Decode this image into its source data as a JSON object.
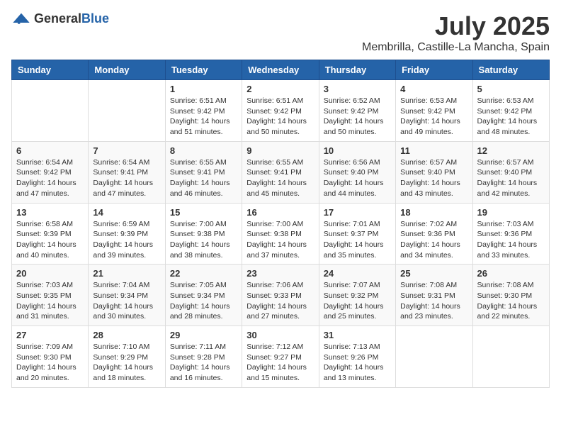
{
  "logo": {
    "general": "General",
    "blue": "Blue"
  },
  "title": "July 2025",
  "subtitle": "Membrilla, Castille-La Mancha, Spain",
  "days_of_week": [
    "Sunday",
    "Monday",
    "Tuesday",
    "Wednesday",
    "Thursday",
    "Friday",
    "Saturday"
  ],
  "weeks": [
    [
      {
        "day": "",
        "sunrise": "",
        "sunset": "",
        "daylight": ""
      },
      {
        "day": "",
        "sunrise": "",
        "sunset": "",
        "daylight": ""
      },
      {
        "day": "1",
        "sunrise": "Sunrise: 6:51 AM",
        "sunset": "Sunset: 9:42 PM",
        "daylight": "Daylight: 14 hours and 51 minutes."
      },
      {
        "day": "2",
        "sunrise": "Sunrise: 6:51 AM",
        "sunset": "Sunset: 9:42 PM",
        "daylight": "Daylight: 14 hours and 50 minutes."
      },
      {
        "day": "3",
        "sunrise": "Sunrise: 6:52 AM",
        "sunset": "Sunset: 9:42 PM",
        "daylight": "Daylight: 14 hours and 50 minutes."
      },
      {
        "day": "4",
        "sunrise": "Sunrise: 6:53 AM",
        "sunset": "Sunset: 9:42 PM",
        "daylight": "Daylight: 14 hours and 49 minutes."
      },
      {
        "day": "5",
        "sunrise": "Sunrise: 6:53 AM",
        "sunset": "Sunset: 9:42 PM",
        "daylight": "Daylight: 14 hours and 48 minutes."
      }
    ],
    [
      {
        "day": "6",
        "sunrise": "Sunrise: 6:54 AM",
        "sunset": "Sunset: 9:42 PM",
        "daylight": "Daylight: 14 hours and 47 minutes."
      },
      {
        "day": "7",
        "sunrise": "Sunrise: 6:54 AM",
        "sunset": "Sunset: 9:41 PM",
        "daylight": "Daylight: 14 hours and 47 minutes."
      },
      {
        "day": "8",
        "sunrise": "Sunrise: 6:55 AM",
        "sunset": "Sunset: 9:41 PM",
        "daylight": "Daylight: 14 hours and 46 minutes."
      },
      {
        "day": "9",
        "sunrise": "Sunrise: 6:55 AM",
        "sunset": "Sunset: 9:41 PM",
        "daylight": "Daylight: 14 hours and 45 minutes."
      },
      {
        "day": "10",
        "sunrise": "Sunrise: 6:56 AM",
        "sunset": "Sunset: 9:40 PM",
        "daylight": "Daylight: 14 hours and 44 minutes."
      },
      {
        "day": "11",
        "sunrise": "Sunrise: 6:57 AM",
        "sunset": "Sunset: 9:40 PM",
        "daylight": "Daylight: 14 hours and 43 minutes."
      },
      {
        "day": "12",
        "sunrise": "Sunrise: 6:57 AM",
        "sunset": "Sunset: 9:40 PM",
        "daylight": "Daylight: 14 hours and 42 minutes."
      }
    ],
    [
      {
        "day": "13",
        "sunrise": "Sunrise: 6:58 AM",
        "sunset": "Sunset: 9:39 PM",
        "daylight": "Daylight: 14 hours and 40 minutes."
      },
      {
        "day": "14",
        "sunrise": "Sunrise: 6:59 AM",
        "sunset": "Sunset: 9:39 PM",
        "daylight": "Daylight: 14 hours and 39 minutes."
      },
      {
        "day": "15",
        "sunrise": "Sunrise: 7:00 AM",
        "sunset": "Sunset: 9:38 PM",
        "daylight": "Daylight: 14 hours and 38 minutes."
      },
      {
        "day": "16",
        "sunrise": "Sunrise: 7:00 AM",
        "sunset": "Sunset: 9:38 PM",
        "daylight": "Daylight: 14 hours and 37 minutes."
      },
      {
        "day": "17",
        "sunrise": "Sunrise: 7:01 AM",
        "sunset": "Sunset: 9:37 PM",
        "daylight": "Daylight: 14 hours and 35 minutes."
      },
      {
        "day": "18",
        "sunrise": "Sunrise: 7:02 AM",
        "sunset": "Sunset: 9:36 PM",
        "daylight": "Daylight: 14 hours and 34 minutes."
      },
      {
        "day": "19",
        "sunrise": "Sunrise: 7:03 AM",
        "sunset": "Sunset: 9:36 PM",
        "daylight": "Daylight: 14 hours and 33 minutes."
      }
    ],
    [
      {
        "day": "20",
        "sunrise": "Sunrise: 7:03 AM",
        "sunset": "Sunset: 9:35 PM",
        "daylight": "Daylight: 14 hours and 31 minutes."
      },
      {
        "day": "21",
        "sunrise": "Sunrise: 7:04 AM",
        "sunset": "Sunset: 9:34 PM",
        "daylight": "Daylight: 14 hours and 30 minutes."
      },
      {
        "day": "22",
        "sunrise": "Sunrise: 7:05 AM",
        "sunset": "Sunset: 9:34 PM",
        "daylight": "Daylight: 14 hours and 28 minutes."
      },
      {
        "day": "23",
        "sunrise": "Sunrise: 7:06 AM",
        "sunset": "Sunset: 9:33 PM",
        "daylight": "Daylight: 14 hours and 27 minutes."
      },
      {
        "day": "24",
        "sunrise": "Sunrise: 7:07 AM",
        "sunset": "Sunset: 9:32 PM",
        "daylight": "Daylight: 14 hours and 25 minutes."
      },
      {
        "day": "25",
        "sunrise": "Sunrise: 7:08 AM",
        "sunset": "Sunset: 9:31 PM",
        "daylight": "Daylight: 14 hours and 23 minutes."
      },
      {
        "day": "26",
        "sunrise": "Sunrise: 7:08 AM",
        "sunset": "Sunset: 9:30 PM",
        "daylight": "Daylight: 14 hours and 22 minutes."
      }
    ],
    [
      {
        "day": "27",
        "sunrise": "Sunrise: 7:09 AM",
        "sunset": "Sunset: 9:30 PM",
        "daylight": "Daylight: 14 hours and 20 minutes."
      },
      {
        "day": "28",
        "sunrise": "Sunrise: 7:10 AM",
        "sunset": "Sunset: 9:29 PM",
        "daylight": "Daylight: 14 hours and 18 minutes."
      },
      {
        "day": "29",
        "sunrise": "Sunrise: 7:11 AM",
        "sunset": "Sunset: 9:28 PM",
        "daylight": "Daylight: 14 hours and 16 minutes."
      },
      {
        "day": "30",
        "sunrise": "Sunrise: 7:12 AM",
        "sunset": "Sunset: 9:27 PM",
        "daylight": "Daylight: 14 hours and 15 minutes."
      },
      {
        "day": "31",
        "sunrise": "Sunrise: 7:13 AM",
        "sunset": "Sunset: 9:26 PM",
        "daylight": "Daylight: 14 hours and 13 minutes."
      },
      {
        "day": "",
        "sunrise": "",
        "sunset": "",
        "daylight": ""
      },
      {
        "day": "",
        "sunrise": "",
        "sunset": "",
        "daylight": ""
      }
    ]
  ]
}
